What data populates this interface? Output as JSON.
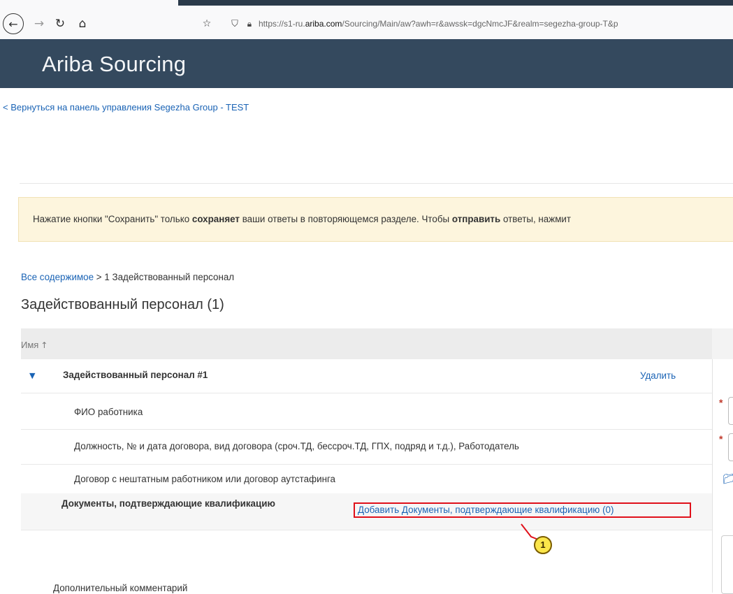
{
  "browser": {
    "url_prefix": "https://s1-ru.",
    "url_domain": "ariba.com",
    "url_suffix": "/Sourcing/Main/aw?awh=r&awssk=dgcNmcJF&realm=segezha-group-T&p",
    "icons": {
      "back": "arrow-left-icon",
      "forward": "arrow-right-icon",
      "reload": "reload-icon",
      "home": "home-icon",
      "bookmark": "bookmark-icon",
      "shield": "shield-icon",
      "lock": "lock-icon"
    }
  },
  "header": {
    "title": "Ariba Sourcing",
    "background": "#34495e"
  },
  "back_link": "< Вернуться на панель управления Segezha Group - TEST",
  "notice": {
    "part1": "Нажатие кнопки \"Сохранить\" только ",
    "bold1": "сохраняет",
    "part2": " ваши ответы в повторяющемся разделе. Чтобы ",
    "bold2": "отправить",
    "part3": " ответы, нажмит"
  },
  "breadcrumb": {
    "link": "Все содержимое",
    "separator": " > ",
    "current": "1 Задействованный персонал"
  },
  "page_title": "Задействованный персонал (1)",
  "table": {
    "column_name": "Имя",
    "group": {
      "title": "Задействованный персонал #1",
      "delete_label": "Удалить"
    },
    "rows": [
      {
        "label": "ФИО работника",
        "required": "*"
      },
      {
        "label": "Должность, № и дата договора, вид договора (сроч.ТД, бессроч.ТД, ГПХ, подряд и т.д.), Работодатель",
        "required": "*"
      },
      {
        "label": "Договор с нештатным работником или договор аутстафинга"
      }
    ],
    "docs": {
      "label": "Документы, подтверждающие квалификацию",
      "add_link": "Добавить Документы, подтверждающие квалификацию (0)"
    },
    "comment_label": "Дополнительный комментарий"
  },
  "callout": {
    "number": "1",
    "color": "#fbe64a"
  },
  "colors": {
    "link": "#1a63b5",
    "highlight": "#e0101a",
    "notice_bg": "#fdf5dd"
  }
}
